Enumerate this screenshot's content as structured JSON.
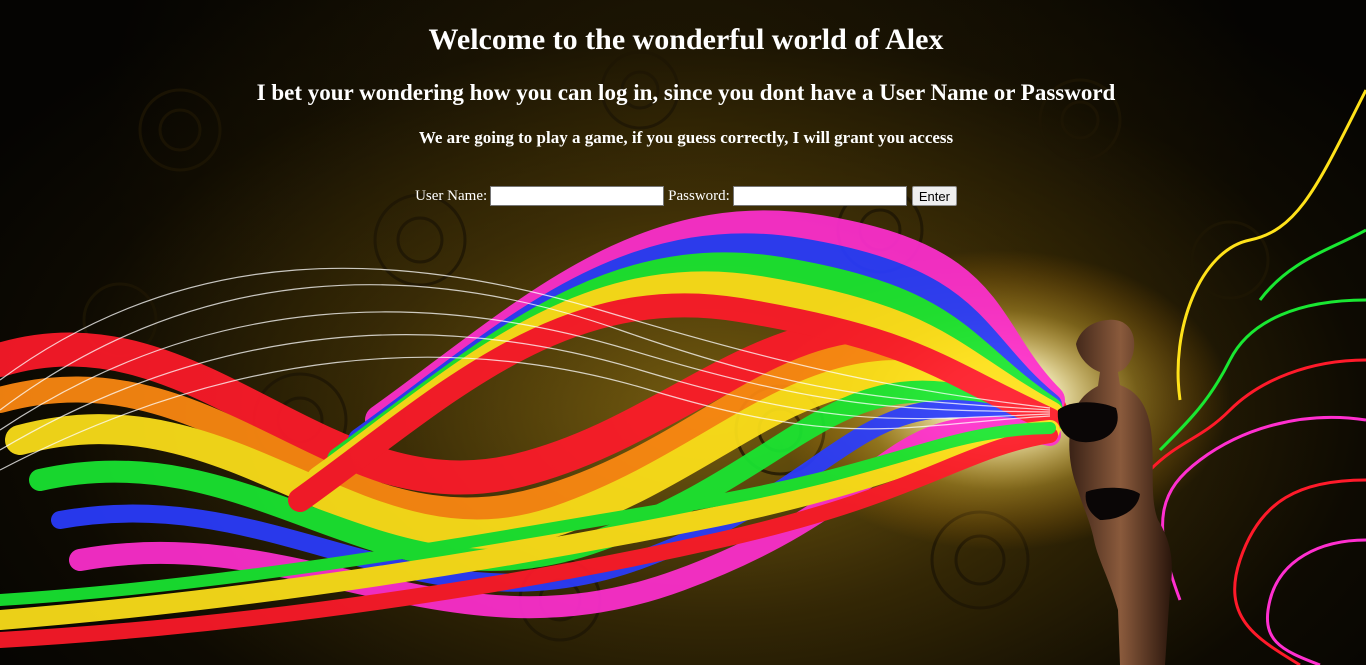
{
  "page": {
    "heading": "Welcome to the wonderful world of Alex",
    "subheading": "I bet your wondering how you can log in, since you dont have a User Name or Password",
    "challenge_text": "We are going to play a game, if you guess correctly, I will grant you access"
  },
  "login_form": {
    "username_label": "User Name:",
    "username_value": "",
    "password_label": "Password:",
    "password_value": "",
    "submit_label": "Enter"
  },
  "background": {
    "description_colors": {
      "base": "#050402",
      "gold_pattern": "#8a6a10",
      "ribbon_red": "#ff1a2a",
      "ribbon_yellow": "#ffe21a",
      "ribbon_green": "#19e832",
      "ribbon_magenta": "#ff2fd0",
      "ribbon_blue": "#2a3cff",
      "glow": "#fffbe0"
    },
    "figure_icon": "person-silhouette"
  }
}
